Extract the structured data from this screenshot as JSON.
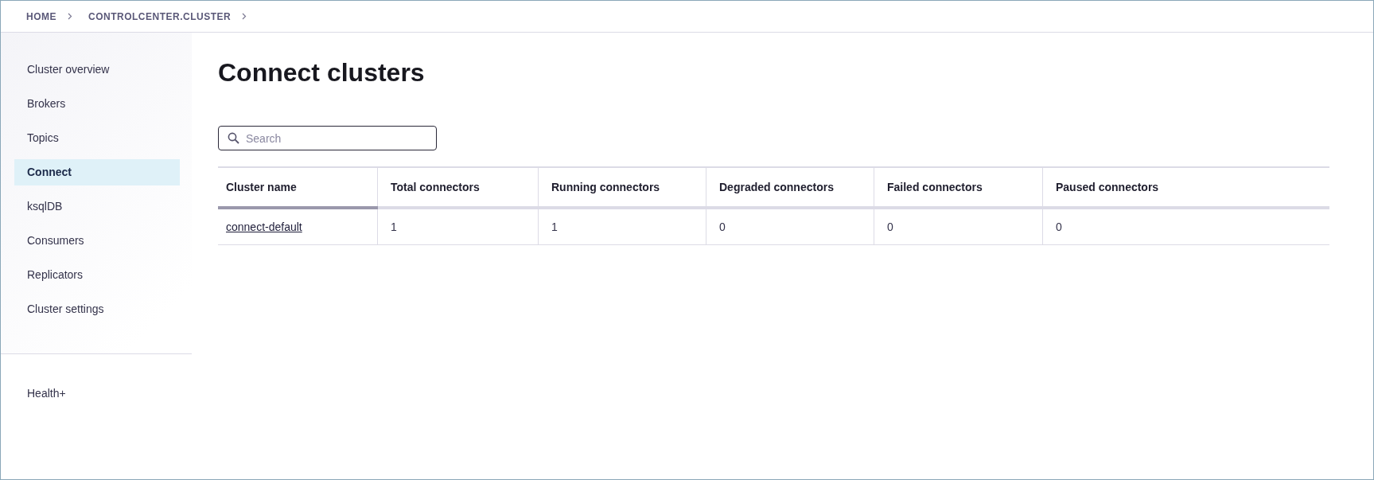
{
  "breadcrumb": [
    "HOME",
    "CONTROLCENTER.CLUSTER"
  ],
  "sidebar": {
    "items": [
      {
        "label": "Cluster overview",
        "selected": false
      },
      {
        "label": "Brokers",
        "selected": false
      },
      {
        "label": "Topics",
        "selected": false
      },
      {
        "label": "Connect",
        "selected": true
      },
      {
        "label": "ksqlDB",
        "selected": false
      },
      {
        "label": "Consumers",
        "selected": false
      },
      {
        "label": "Replicators",
        "selected": false
      },
      {
        "label": "Cluster settings",
        "selected": false
      }
    ],
    "footer_items": [
      {
        "label": "Health+",
        "selected": false
      }
    ]
  },
  "title": "Connect clusters",
  "search": {
    "placeholder": "Search"
  },
  "table": {
    "columns": [
      {
        "label": "Cluster name",
        "sorted": true
      },
      {
        "label": "Total connectors",
        "sorted": false
      },
      {
        "label": "Running connectors",
        "sorted": false
      },
      {
        "label": "Degraded connectors",
        "sorted": false
      },
      {
        "label": "Failed connectors",
        "sorted": false
      },
      {
        "label": "Paused connectors",
        "sorted": false
      }
    ],
    "rows": [
      [
        "connect-default",
        "1",
        "1",
        "0",
        "0",
        "0"
      ]
    ]
  }
}
